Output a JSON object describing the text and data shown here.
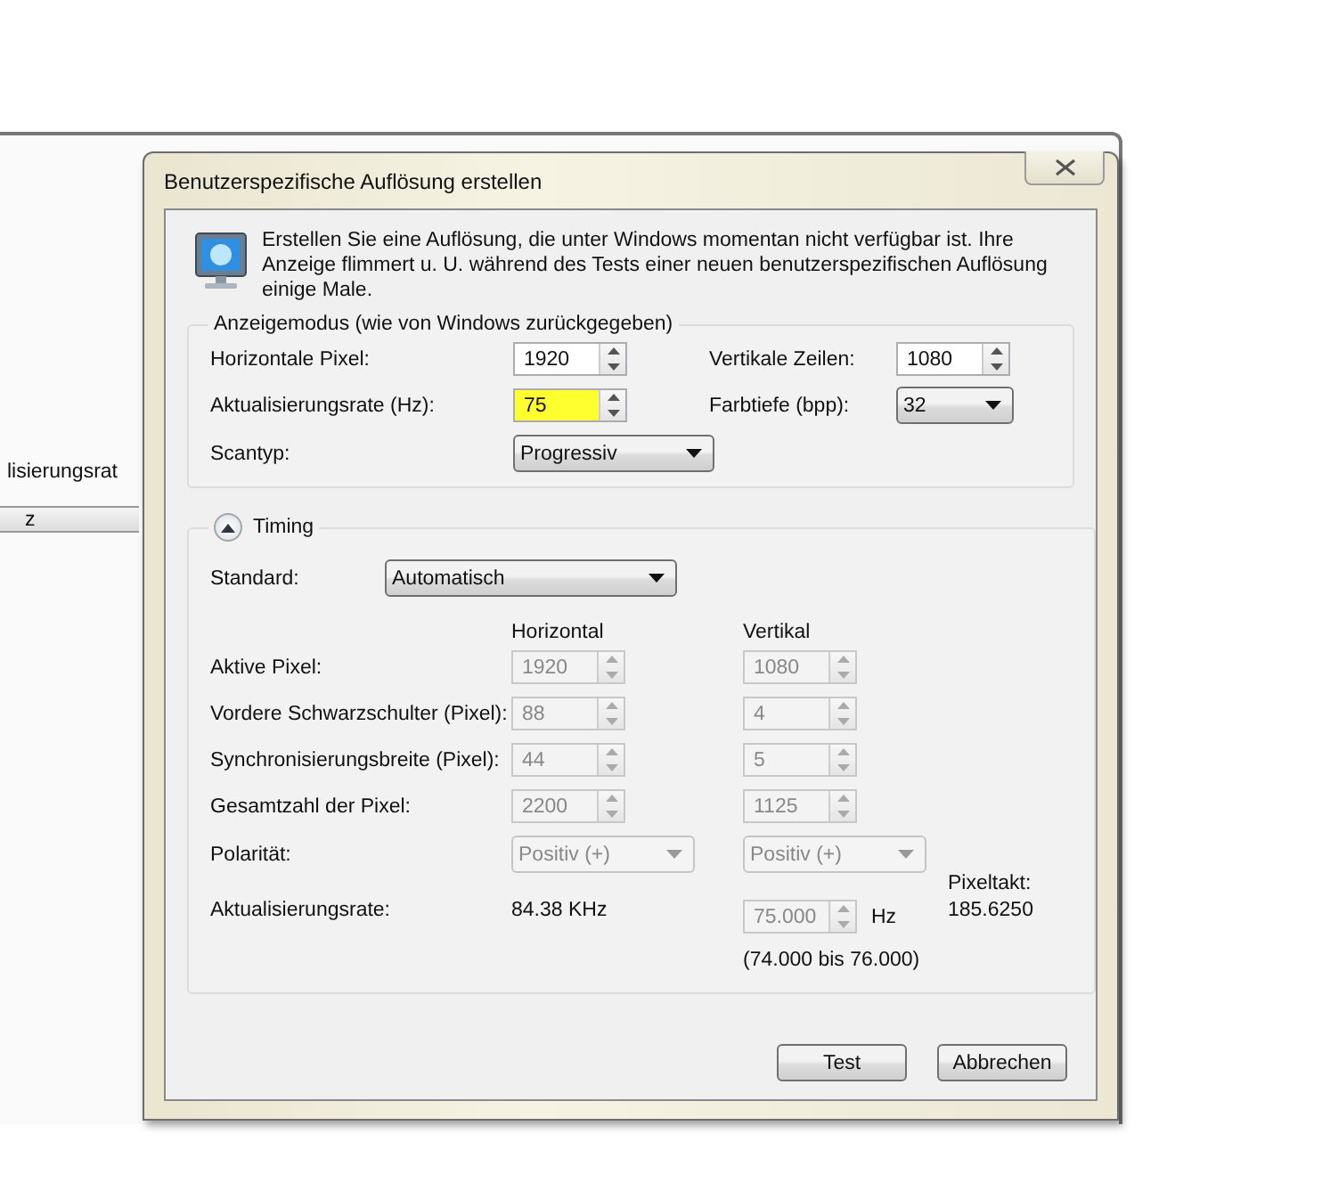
{
  "background_window": {
    "label": "lisierungsrat",
    "field_value": "z"
  },
  "dialog": {
    "title": "Benutzerspezifische Auflösung erstellen",
    "intro": "Erstellen Sie eine Auflösung, die unter Windows momentan nicht verfügbar ist. Ihre Anzeige flimmert u. U. während des Tests einer neuen benutzerspezifischen Auflösung einige Male.",
    "display_mode": {
      "legend": "Anzeigemodus (wie von Windows zurückgegeben)",
      "fields": [
        {
          "label": "Horizontale Pixel:",
          "kind": "spinner",
          "value": "1920",
          "highlighted": false
        },
        {
          "label": "Vertikale Zeilen:",
          "kind": "spinner",
          "value": "1080",
          "highlighted": false
        },
        {
          "label": "Aktualisierungsrate (Hz):",
          "kind": "spinner",
          "value": "75",
          "highlighted": true
        },
        {
          "label": "Farbtiefe (bpp):",
          "kind": "dropdown",
          "value": "32"
        },
        {
          "label": "Scantyp:",
          "kind": "dropdown",
          "value": "Progressiv"
        }
      ]
    },
    "timing": {
      "title": "Timing",
      "expanded": true,
      "standard": {
        "label": "Standard:",
        "value": "Automatisch"
      },
      "columns": [
        "Horizontal",
        "Vertikal"
      ],
      "rows": [
        {
          "label": "Aktive Pixel:",
          "kind": "spinner",
          "horizontal": "1920",
          "vertical": "1080",
          "disabled": true
        },
        {
          "label": "Vordere Schwarzschulter (Pixel):",
          "kind": "spinner",
          "horizontal": "88",
          "vertical": "4",
          "disabled": true
        },
        {
          "label": "Synchronisierungsbreite (Pixel):",
          "kind": "spinner",
          "horizontal": "44",
          "vertical": "5",
          "disabled": true
        },
        {
          "label": "Gesamtzahl der Pixel:",
          "kind": "spinner",
          "horizontal": "2200",
          "vertical": "1125",
          "disabled": true
        },
        {
          "label": "Polarität:",
          "kind": "dropdown",
          "horizontal": "Positiv (+)",
          "vertical": "Positiv (+)",
          "disabled": true
        }
      ],
      "refresh": {
        "label": "Aktualisierungsrate:",
        "horizontal": "84.38 KHz",
        "vertical": "75.000",
        "unit": "Hz",
        "range": "(74.000 bis 76.000)",
        "disabled": true
      },
      "pixel_clock": {
        "label": "Pixeltakt:",
        "value": "185.6250"
      }
    },
    "buttons": [
      "Test",
      "Abbrechen"
    ]
  }
}
